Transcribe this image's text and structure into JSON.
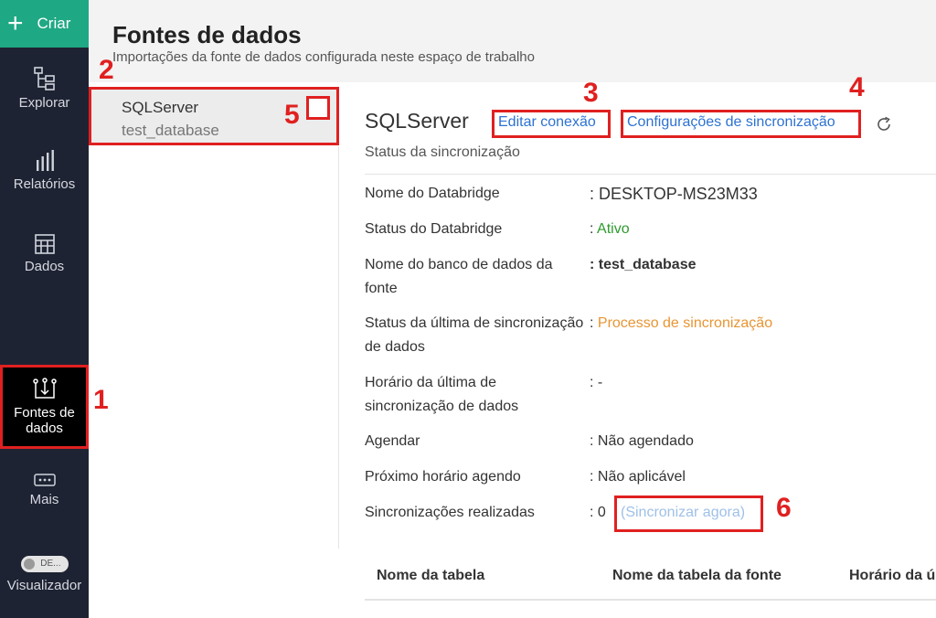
{
  "nav": {
    "create_label": "Criar",
    "items": [
      {
        "label": "Explorar",
        "icon": "explore-icon"
      },
      {
        "label": "Relatórios",
        "icon": "reports-icon"
      },
      {
        "label": "Dados",
        "icon": "data-table-icon"
      },
      {
        "label": "Fontes de dados",
        "icon": "data-sources-icon",
        "active": true
      },
      {
        "label": "Mais",
        "icon": "more-icon"
      },
      {
        "label": "Visualizador",
        "icon": "viewer-toggle-icon"
      }
    ],
    "toggle_text": "DE..."
  },
  "header": {
    "title": "Fontes de dados",
    "subtitle": "Importações da fonte de dados configurada neste espaço de trabalho"
  },
  "sources": [
    {
      "name": "SQLServer",
      "database": "test_database",
      "selected": true
    }
  ],
  "detail": {
    "title": "SQLServer",
    "edit_connection": "Editar conexão",
    "sync_settings": "Configurações de sincronização",
    "sync_status_heading": "Status da sincronização",
    "rows": [
      {
        "label": "Nome do Databridge",
        "value": ": DESKTOP-MS23M33"
      },
      {
        "label": "Status do Databridge",
        "prefix": ": ",
        "value": "Ativo"
      },
      {
        "label": "Nome do banco de dados da fonte",
        "value": ": test_database"
      },
      {
        "label": "Status da última de sincronização de dados",
        "prefix": ": ",
        "value": "Processo de sincronização"
      },
      {
        "label": "Horário da última de sincronização de dados",
        "value": ": -"
      },
      {
        "label": "Agendar",
        "value": ": Não agendado"
      },
      {
        "label": "Próximo horário agendo",
        "value": ": Não aplicável"
      },
      {
        "label": "Sincronizações realizadas",
        "value": ": 0"
      }
    ],
    "sync_now": "(Sincronizar agora)",
    "table_headers": [
      "Nome da tabela",
      "Nome da tabela da fonte",
      "Horário da ú"
    ]
  },
  "annotations": [
    "1",
    "2",
    "3",
    "4",
    "5",
    "6"
  ],
  "colors": {
    "nav_bg": "#1e2333",
    "create_bg": "#1fa884",
    "link": "#2d72d2",
    "active_green": "#2e9b2e",
    "sync_orange": "#e89533",
    "annotation_red": "#e02020"
  }
}
